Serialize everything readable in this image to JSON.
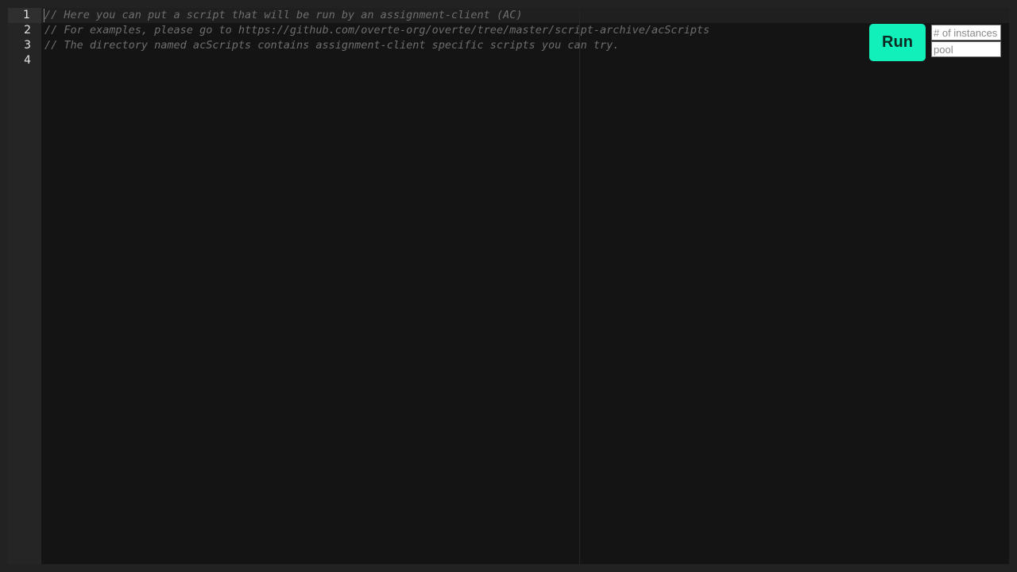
{
  "editor": {
    "line_numbers": [
      "1",
      "2",
      "3",
      "4"
    ],
    "lines": [
      "// Here you can put a script that will be run by an assignment-client (AC)",
      "// For examples, please go to https://github.com/overte-org/overte/tree/master/script-archive/acScripts",
      "// The directory named acScripts contains assignment-client specific scripts you can try.",
      ""
    ]
  },
  "controls": {
    "run_label": "Run",
    "instances_placeholder": "# of instances",
    "pool_placeholder": "pool"
  },
  "colors": {
    "run_button": "#11f0bb",
    "editor_background": "#141414",
    "comment_text": "#6e6e6e"
  }
}
